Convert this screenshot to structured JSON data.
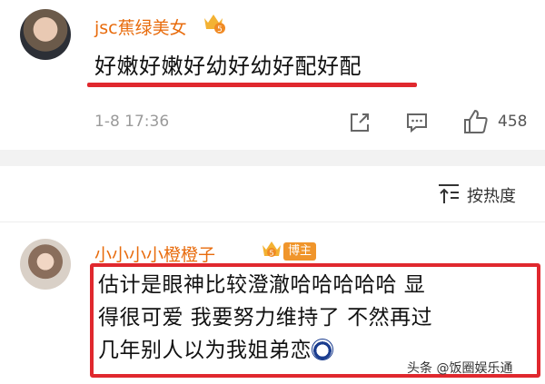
{
  "comments": [
    {
      "username": "jsc蕉绿美女",
      "level_badge": "5",
      "content": "好嫩好嫩好幼好幼好配好配",
      "time": "1-8 17:36",
      "likes": "458"
    },
    {
      "username": "小小小小橙橙子",
      "level_badge": "5",
      "role_badge": "博主",
      "content": "估计是眼神比较澄澈哈哈哈哈哈 显得很可爱  我要努力维持了 不然再过几年别人以为我姐弟恋"
    }
  ],
  "sort": {
    "label": "按热度"
  },
  "watermark": "头条 @饭圈娱乐通",
  "colors": {
    "username": "#e86b0c",
    "highlight": "#e0282e",
    "badge": "#f0952b"
  }
}
